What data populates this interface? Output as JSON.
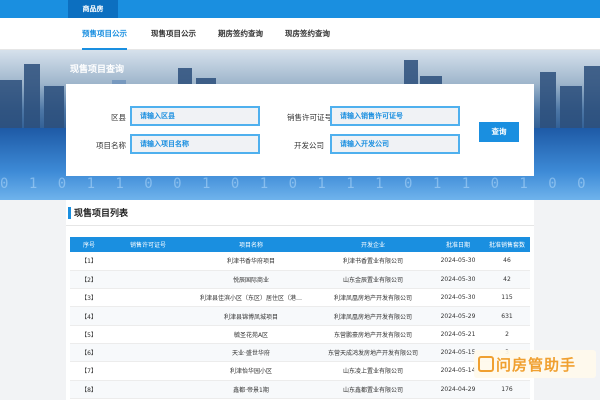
{
  "topbar": {
    "category": "商品房"
  },
  "tabs": [
    {
      "label": "预售项目公示"
    },
    {
      "label": "现售项目公示"
    },
    {
      "label": "期房签约查询"
    },
    {
      "label": "现房签约查询"
    }
  ],
  "banner": {
    "title": "现售项目查询",
    "binary": "0 1 0 1 1 0 0 1 0 1 0 1 1 1 0 1 1 0 1 0 0 1"
  },
  "search": {
    "district_label": "区县",
    "district_placeholder": "请输入区县",
    "permit_label": "销售许可证号",
    "permit_placeholder": "请输入销售许可证号",
    "project_label": "项目名称",
    "project_placeholder": "请输入项目名称",
    "developer_label": "开发公司",
    "developer_placeholder": "请输入开发公司",
    "button": "查询"
  },
  "list": {
    "title": "现售项目列表",
    "columns": [
      "序号",
      "销售许可证号",
      "项目名称",
      "开发企业",
      "批准日期",
      "批准销售套数"
    ],
    "rows": [
      [
        "【1】",
        "",
        "利津书香华府项目",
        "利津书香置业有限公司",
        "2024-05-30",
        "46"
      ],
      [
        "【2】",
        "",
        "悦辰国际商业",
        "山东金辰置业有限公司",
        "2024-05-30",
        "42"
      ],
      [
        "【3】",
        "",
        "利津县佳滨小区（东区）居住区（港…",
        "利津凤凰房地产开发有限公司",
        "2024-05-30",
        "115"
      ],
      [
        "【4】",
        "",
        "利津县锦博凤城项目",
        "利津凤凰房地产开发有限公司",
        "2024-05-29",
        "631"
      ],
      [
        "【5】",
        "",
        "毓圣花苑A区",
        "东营鹏豪房地产开发有限公司",
        "2024-05-21",
        "2"
      ],
      [
        "【6】",
        "",
        "天业·盛世华府",
        "东营天成鸿发房地产开发有限公司",
        "2024-05-15",
        "3"
      ],
      [
        "【7】",
        "",
        "利津怡华园小区",
        "山东凌上置业有限公司",
        "2024-05-14",
        ""
      ],
      [
        "【8】",
        "",
        "鑫都·帝景1期",
        "山东鑫都置业有限公司",
        "2024-04-29",
        "176"
      ]
    ]
  },
  "watermark": {
    "text": "问房管助手"
  },
  "colors": {
    "accent": "#1a8fe0",
    "watermark": "#f0a030"
  }
}
